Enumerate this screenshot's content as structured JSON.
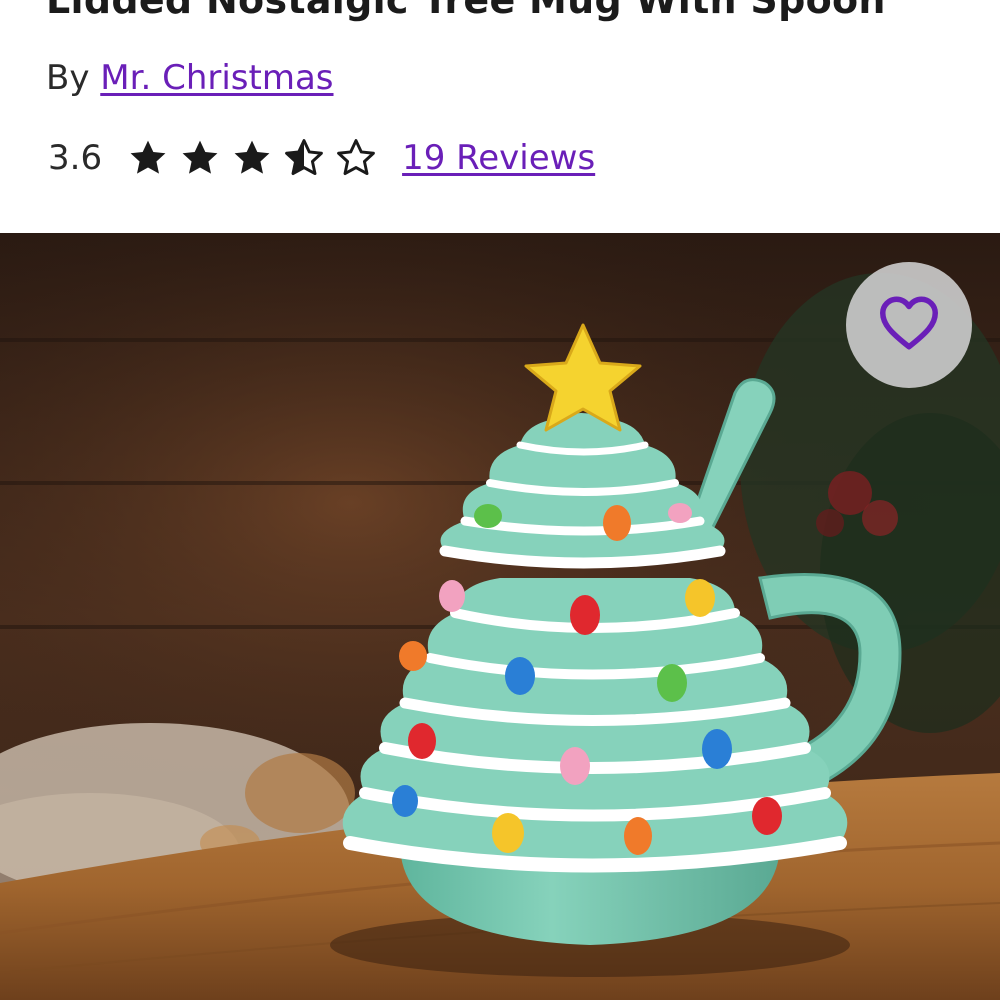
{
  "product": {
    "title": "Lidded Nostalgic Tree Mug With Spoon",
    "by_label": "By",
    "brand": "Mr. Christmas"
  },
  "rating": {
    "value": "3.6",
    "stars": 3.5,
    "max_stars": 5,
    "reviews_label": "19 Reviews"
  },
  "image": {
    "subject": "green ceramic christmas tree mug with lid, star topper and spoon"
  },
  "favorite": {
    "icon": "heart-outline-icon"
  },
  "colors": {
    "accent": "#6a1fb8",
    "star": "#1a1a1a",
    "mug": "#7fcdb5"
  }
}
